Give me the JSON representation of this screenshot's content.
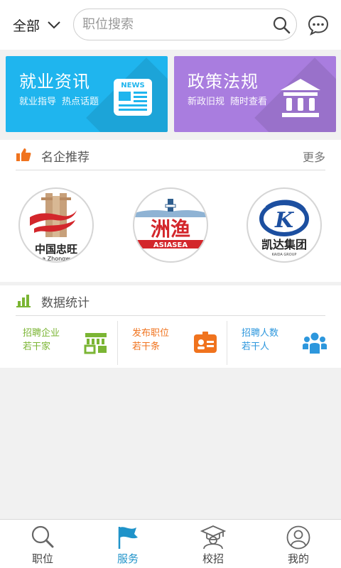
{
  "header": {
    "area_label": "全部",
    "search_placeholder": "职位搜索"
  },
  "cards": [
    {
      "title": "就业资讯",
      "subs": [
        "就业指导",
        "热点话题"
      ],
      "icon": "newspaper-icon",
      "icon_text": "NEWS",
      "color": "#1fb5ee"
    },
    {
      "title": "政策法规",
      "subs": [
        "新政旧规",
        "随时查看"
      ],
      "icon": "court-building-icon",
      "color": "#a97ddf"
    }
  ],
  "companies": {
    "title": "名企推荐",
    "more": "更多",
    "logos": [
      {
        "name": "中国忠旺",
        "sub": "a Zhongw"
      },
      {
        "name": "洲渔",
        "sub": "ASIASEA"
      },
      {
        "name": "凯达集团",
        "sub": "KAIDA GROUP"
      }
    ]
  },
  "stats": {
    "title": "数据统计",
    "items": [
      {
        "line1": "招聘企业",
        "line2": "若干家",
        "color": "#7bb534",
        "icon": "company-stat-icon"
      },
      {
        "line1": "发布职位",
        "line2": "若干条",
        "color": "#f0731e",
        "icon": "id-card-icon"
      },
      {
        "line1": "招聘人数",
        "line2": "若干人",
        "color": "#2d97dd",
        "icon": "people-icon"
      }
    ]
  },
  "tabs": [
    {
      "label": "职位",
      "icon": "search-icon",
      "active": false
    },
    {
      "label": "服务",
      "icon": "flag-icon",
      "active": true
    },
    {
      "label": "校招",
      "icon": "graduate-icon",
      "active": false
    },
    {
      "label": "我的",
      "icon": "user-icon",
      "active": false
    }
  ],
  "colors": {
    "active": "#1f93c9",
    "news": "#1fb5ee",
    "policy": "#a97ddf"
  }
}
